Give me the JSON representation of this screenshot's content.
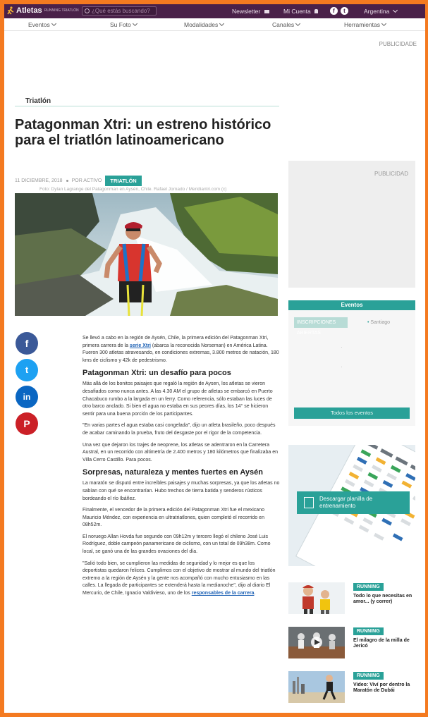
{
  "topbar": {
    "logo": "Atletas",
    "logo_sub": "RUNNING TRIATLÓN",
    "search_placeholder": "¿Qué estás buscando?",
    "newsletter": "Newsletter",
    "account": "Mi Cuenta",
    "region": "Argentina"
  },
  "nav": {
    "items": [
      "Eventos",
      "Su Foto",
      "Modalidades",
      "Canales",
      "Herramientas"
    ]
  },
  "publicidad_top": "PUBLICIDADE",
  "article": {
    "section": "Triatlón",
    "title": "Patagonman Xtri: un estreno histórico para el triatlón latinoamericano",
    "date": "11 DICIEMBRE, 2018",
    "author": "POR ACTIVO",
    "tag": "TRIATLÓN",
    "caption": "Foto: Dylan Lagrange del Patagonman en Aysén, Chile. Rafael Jornado / Meridiantri.com (c)",
    "p1_a": "Se llevó a cabo en la región de Aysén, Chile, la primera edición del Patagonman Xtri, primera carrera de la ",
    "p1_link": "serie Xtri",
    "p1_b": " (abarca la reconocida Norseman) en América Latina. Fueron 300 atletas atravesando, en condiciones extremas, 3.800 metros de natación, 180 kms de ciclismo y 42k de pedestrismo.",
    "h2_1": "Patagonman Xtri: un desafío para pocos",
    "p2": "Más allá de los bonitos paisajes que regaló la región de Aysen, los atletas se vieron desafiados como nunca antes. A las 4.30 AM el grupo de atletas se embarcó en Puerto Chacabuco rumbo a la largada en un ferry. Como referencia, sólo estaban las luces de otro barco anclado. Si bien el agua no estaba en sus peores días, los 14° se hicieron sentir para una buena porción de los participantes.",
    "p3": "\"En varias partes el agua estaba casi congelada\", dijo un atleta brasileño, poco después de acabar caminando la prueba, fruto del desgaste por el rigor de la competencia.",
    "p4": "Una vez que dejaron los trajes de neoprene, los atletas se adentraron en la Carretera Austral, en un recorrido con altimetría de 2.400 metros y 180 kilómetros que finalizaba en Villa Cerro Castillo. Para pocos.",
    "h2_2": "Sorpresas, naturaleza y mentes fuertes en Aysén",
    "p5": "La maratón se disputó entre increíbles paisajes y muchas sorpresas, ya que los atletas no sabían con qué se encontrarían. Hubo trechos de tierra batida y senderos rústicos bordeando el río Ibáñez.",
    "p6": "Finalmente, el vencedor de la primera edición del Patagonman Xtri fue el mexicano Mauricio Méndez, con experiencia en ultratriatlones, quien completó el recorrido en 08h52m.",
    "p7": "El noruego Allan Hovda fue segundo con 09h12m y tercero llegó el chileno José Luis Rodríguez, doble campeón panamericano de ciclismo, con un total de 09h38m. Como local, se ganó una de las grandes ovaciones del día.",
    "p8_a": "\"Salió todo bien, se cumplieron las medidas de seguridad y lo mejor es que los deportistas quedaron felices. Cumplimos con el objetivo de mostrar al mundo del triatlón extremo a la región de Aysén y la gente nos acompañó con mucho entusiasmo en las calles. La llegada de participantes se extenderá hasta la medianoche\", dijo al diario El Mercurio, de Chile, Ignacio Valdivieso, uno de los ",
    "p8_link": "responsables de la carrera",
    "p8_b": "."
  },
  "share": {
    "facebook": "f",
    "twitter": "t",
    "linkedin": "in",
    "pinterest": "P"
  },
  "sidebar": {
    "publicidad": "PUBLICIDAD",
    "events_title": "Eventos",
    "events_filter": "INSCRIPCIONES ABIERTAS",
    "events_location": "Santiago",
    "events_all": "Todos los eventos",
    "plan_button": "Descargar planilla de entrenamiento",
    "related": [
      {
        "tag": "RUNNING",
        "title": "Todo lo que necesitas en amor... (y correr)"
      },
      {
        "tag": "RUNNING",
        "title": "El milagro de la milla de Jericó"
      },
      {
        "tag": "RUNNING",
        "title": "Video: Viví por dentro la Maratón de Dubái"
      }
    ]
  },
  "colors": {
    "accent": "#2aa198",
    "topbar": "#4a2149",
    "border": "#f47a20"
  }
}
